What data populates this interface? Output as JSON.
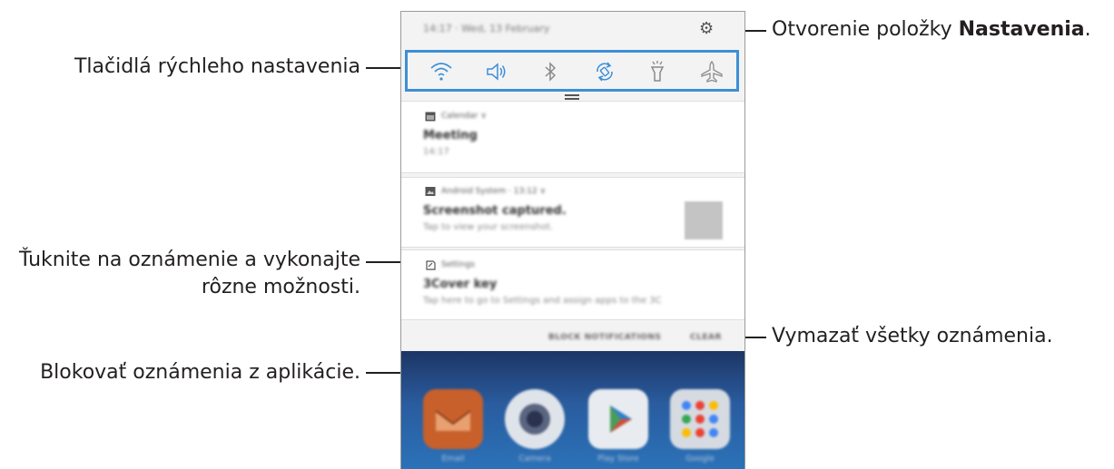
{
  "callouts": {
    "quick_settings": "Tlačidlá rýchleho nastavenia",
    "open_settings_prefix": "Otvorenie položky ",
    "open_settings_bold": "Nastavenia",
    "open_settings_suffix": ".",
    "tap_notification_line1": "Ťuknite na oznámenie a vykonajte",
    "tap_notification_line2": "rôzne možnosti.",
    "block_notifications": "Blokovať oznámenia z aplikácie.",
    "clear_all": "Vymazať všetky oznámenia."
  },
  "phone": {
    "status_text": "14:17 · Wed, 13 February",
    "quick_settings_icons": [
      "wifi-icon",
      "sound-icon",
      "bluetooth-icon",
      "auto-rotate-icon",
      "flashlight-icon",
      "airplane-mode-icon"
    ],
    "notifications": [
      {
        "app": "Calendar ∨",
        "title": "Meeting",
        "subtitle": "14:17",
        "icon": "calendar-icon"
      },
      {
        "app": "Android System · 13:12 ∨",
        "title": "Screenshot captured.",
        "subtitle": "Tap to view your screenshot.",
        "icon": "image-icon"
      },
      {
        "app": "Settings",
        "title": "3Cover key",
        "subtitle": "Tap here to go to Settings and assign apps to the 3C",
        "icon": "settings-note-icon"
      }
    ],
    "actions": {
      "block": "BLOCK NOTIFICATIONS",
      "clear": "CLEAR"
    },
    "apps": [
      {
        "label": "Email",
        "icon": "email-icon",
        "color": "#c8602c"
      },
      {
        "label": "Camera",
        "icon": "camera-icon",
        "color": "#dfe4ea"
      },
      {
        "label": "Play Store",
        "icon": "play-store-icon",
        "color": "#e8ecf0"
      },
      {
        "label": "Google",
        "icon": "google-folder-icon",
        "color": "#d6dbe2"
      }
    ]
  }
}
